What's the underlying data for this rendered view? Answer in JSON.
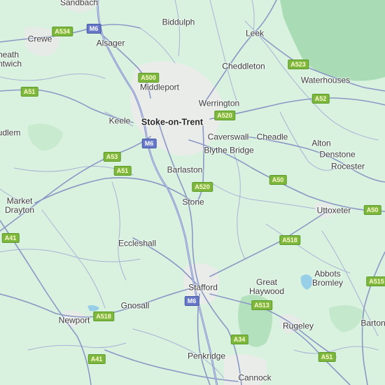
{
  "colors": {
    "land": "#d8f2df",
    "urban": "#e9ece9",
    "park": "#bfe6c8",
    "forest": "#a9dcb5",
    "water": "#98cfe8",
    "road": "#8b98c5",
    "motorway": "#7c8bc8",
    "a_road_shield": "#7eb73e",
    "motorway_shield": "#6677c8"
  },
  "places": [
    {
      "id": "sandbach",
      "label": "Sandbach",
      "type": "town"
    },
    {
      "id": "crewe",
      "label": "Crewe",
      "type": "town"
    },
    {
      "id": "nantwich",
      "label": "heath\nntwich",
      "type": "town"
    },
    {
      "id": "alsager",
      "label": "Alsager",
      "type": "town"
    },
    {
      "id": "biddulph",
      "label": "Biddulph",
      "type": "town"
    },
    {
      "id": "leek",
      "label": "Leek",
      "type": "town"
    },
    {
      "id": "cheddleton",
      "label": "Cheddleton",
      "type": "town"
    },
    {
      "id": "waterhouses",
      "label": "Waterhouses",
      "type": "town"
    },
    {
      "id": "middleport",
      "label": "Middleport",
      "type": "town"
    },
    {
      "id": "werrington",
      "label": "Werrington",
      "type": "town"
    },
    {
      "id": "keele",
      "label": "Keele",
      "type": "town"
    },
    {
      "id": "stoke",
      "label": "Stoke-on-Trent",
      "type": "city"
    },
    {
      "id": "caverswall",
      "label": "Caverswall",
      "type": "town"
    },
    {
      "id": "cheadle",
      "label": "Cheadle",
      "type": "town"
    },
    {
      "id": "alton",
      "label": "Alton",
      "type": "town"
    },
    {
      "id": "blythe",
      "label": "Blythe Bridge",
      "type": "town"
    },
    {
      "id": "denstone",
      "label": "Denstone",
      "type": "town"
    },
    {
      "id": "audlem",
      "label": "udlem",
      "type": "town"
    },
    {
      "id": "barlaston",
      "label": "Barlaston",
      "type": "town"
    },
    {
      "id": "rocester",
      "label": "Rocester",
      "type": "town"
    },
    {
      "id": "stone",
      "label": "Stone",
      "type": "town"
    },
    {
      "id": "market_drayton",
      "label": "Market\nDrayton",
      "type": "town"
    },
    {
      "id": "uttoxeter",
      "label": "Uttoxeter",
      "type": "town"
    },
    {
      "id": "eccleshall",
      "label": "Eccleshall",
      "type": "town"
    },
    {
      "id": "abbots_bromley",
      "label": "Abbots\nBromley",
      "type": "town"
    },
    {
      "id": "great_haywood",
      "label": "Great\nHaywood",
      "type": "town"
    },
    {
      "id": "stafford",
      "label": "Stafford",
      "type": "town"
    },
    {
      "id": "gnosall",
      "label": "Gnosall",
      "type": "town"
    },
    {
      "id": "newport",
      "label": "Newport",
      "type": "town"
    },
    {
      "id": "rugeley",
      "label": "Rugeley",
      "type": "town"
    },
    {
      "id": "barton",
      "label": "Barton",
      "type": "town"
    },
    {
      "id": "penkridge",
      "label": "Penkridge",
      "type": "town"
    },
    {
      "id": "cannock",
      "label": "Cannock",
      "type": "town"
    }
  ],
  "road_shields": [
    {
      "id": "a534",
      "label": "A534",
      "kind": "a"
    },
    {
      "id": "m6_n",
      "label": "M6",
      "kind": "m"
    },
    {
      "id": "a523",
      "label": "A523",
      "kind": "a"
    },
    {
      "id": "a500",
      "label": "A500",
      "kind": "a"
    },
    {
      "id": "a51_w",
      "label": "A51",
      "kind": "a"
    },
    {
      "id": "a52",
      "label": "A52",
      "kind": "a"
    },
    {
      "id": "a520_n",
      "label": "A520",
      "kind": "a"
    },
    {
      "id": "m6_c",
      "label": "M6",
      "kind": "m"
    },
    {
      "id": "a53",
      "label": "A53",
      "kind": "a"
    },
    {
      "id": "a51_c",
      "label": "A51",
      "kind": "a"
    },
    {
      "id": "a50_c",
      "label": "A50",
      "kind": "a"
    },
    {
      "id": "a520_s",
      "label": "A520",
      "kind": "a"
    },
    {
      "id": "a50_e",
      "label": "A50",
      "kind": "a"
    },
    {
      "id": "a41_n",
      "label": "A41",
      "kind": "a"
    },
    {
      "id": "a518_e",
      "label": "A518",
      "kind": "a"
    },
    {
      "id": "a515",
      "label": "A515",
      "kind": "a"
    },
    {
      "id": "m6_s",
      "label": "M6",
      "kind": "m"
    },
    {
      "id": "a513",
      "label": "A513",
      "kind": "a"
    },
    {
      "id": "a518_w",
      "label": "A518",
      "kind": "a"
    },
    {
      "id": "a34",
      "label": "A34",
      "kind": "a"
    },
    {
      "id": "a41_s",
      "label": "A41",
      "kind": "a"
    },
    {
      "id": "a51_s",
      "label": "A51",
      "kind": "a"
    }
  ]
}
